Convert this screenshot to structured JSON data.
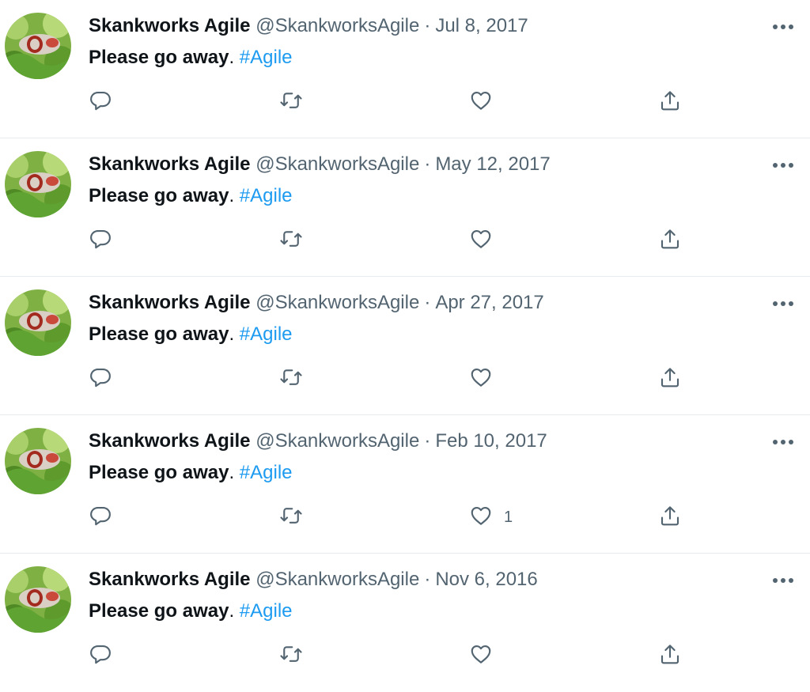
{
  "tweets": [
    {
      "name": "Skankworks Agile",
      "handle": "@SkankworksAgile",
      "separator": "·",
      "date": "Jul 8, 2017",
      "text": "Please go away",
      "punct": ".",
      "hashtag": "#Agile",
      "like_count": ""
    },
    {
      "name": "Skankworks Agile",
      "handle": "@SkankworksAgile",
      "separator": "·",
      "date": "May 12, 2017",
      "text": "Please go away",
      "punct": ".",
      "hashtag": "#Agile",
      "like_count": ""
    },
    {
      "name": "Skankworks Agile",
      "handle": "@SkankworksAgile",
      "separator": "·",
      "date": "Apr 27, 2017",
      "text": "Please go away",
      "punct": ".",
      "hashtag": "#Agile",
      "like_count": ""
    },
    {
      "name": "Skankworks Agile",
      "handle": "@SkankworksAgile",
      "separator": "·",
      "date": "Feb 10, 2017",
      "text": "Please go away",
      "punct": ".",
      "hashtag": "#Agile",
      "like_count": "1"
    },
    {
      "name": "Skankworks Agile",
      "handle": "@SkankworksAgile",
      "separator": "·",
      "date": "Nov 6, 2016",
      "text": "Please go away",
      "punct": ".",
      "hashtag": "#Agile",
      "like_count": ""
    }
  ],
  "icons": {
    "reply": "reply-icon",
    "retweet": "retweet-icon",
    "like": "heart-icon",
    "share": "share-icon",
    "more": "more-icon"
  },
  "colors": {
    "hashtag": "#1d9bf0",
    "secondary_text": "#536471",
    "primary_text": "#0f1419",
    "divider": "#e6ecf0"
  }
}
